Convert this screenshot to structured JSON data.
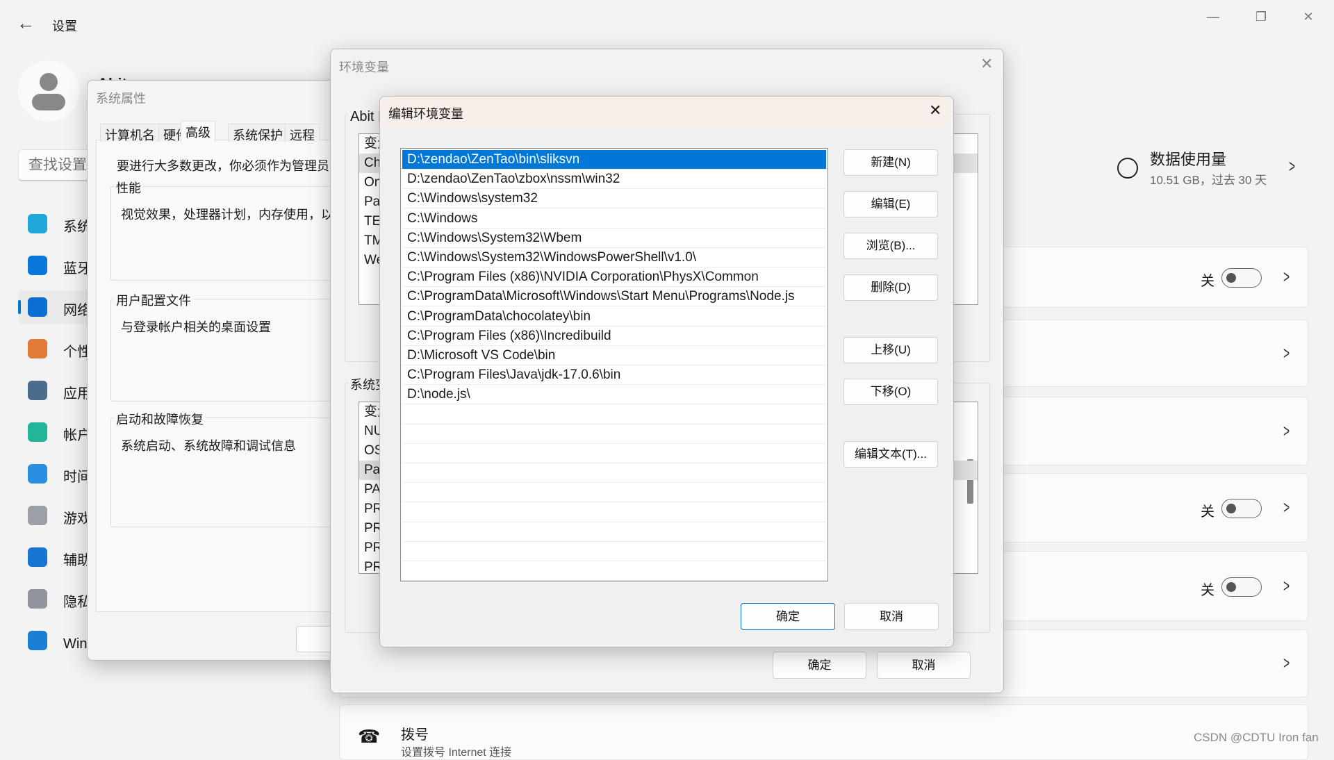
{
  "settings": {
    "title": "设置",
    "search_placeholder": "查找设置",
    "user_name": "Abit",
    "sidebar": [
      {
        "label": "系统",
        "icon": "system-icon",
        "color": "#1ea7d8"
      },
      {
        "label": "蓝牙和其他设备",
        "icon": "bluetooth-icon",
        "color": "#0a76d8"
      },
      {
        "label": "网络和 Internet",
        "icon": "wifi-icon",
        "color": "#0a6fd1",
        "active": true
      },
      {
        "label": "个性化",
        "icon": "brush-icon",
        "color": "#e07a36"
      },
      {
        "label": "应用",
        "icon": "apps-icon",
        "color": "#4a6d8c"
      },
      {
        "label": "帐户",
        "icon": "account-icon",
        "color": "#22b59a"
      },
      {
        "label": "时间和语言",
        "icon": "globe-clock-icon",
        "color": "#2a8fe0"
      },
      {
        "label": "游戏",
        "icon": "gamepad-icon",
        "color": "#9aa0a6"
      },
      {
        "label": "辅助功能",
        "icon": "accessibility-icon",
        "color": "#1675d1"
      },
      {
        "label": "隐私和安全性",
        "icon": "shield-icon",
        "color": "#8f959b"
      },
      {
        "label": "Windows 更新",
        "icon": "update-icon",
        "color": "#1a7fd4"
      }
    ],
    "data_usage": {
      "title": "数据使用量",
      "subtitle": "10.51 GB，过去 30 天"
    },
    "toggle_off_label": "关",
    "dialup": {
      "title": "拨号",
      "subtitle": "设置拨号 Internet 连接"
    },
    "accent": "#0078d4"
  },
  "sysprops": {
    "title": "系统属性",
    "tabs": [
      "计算机名",
      "硬件",
      "高级",
      "系统保护",
      "远程"
    ],
    "active_tab": "高级",
    "admin_note": "要进行大多数更改，你必须作为管理员登录。",
    "groups": [
      {
        "label": "性能",
        "desc": "视觉效果，处理器计划，内存使用，以及虚拟内存"
      },
      {
        "label": "用户配置文件",
        "desc": "与登录帐户相关的桌面设置"
      },
      {
        "label": "启动和故障恢复",
        "desc": "系统启动、系统故障和调试信息"
      }
    ]
  },
  "envvars": {
    "title": "环境变量",
    "user_group_label": "Abit 的用户变量",
    "user_rows": [
      "变量",
      "ChocolateyLastPathUpdate",
      "OneDrive",
      "Path",
      "TEMP",
      "TMP",
      "WebStorm"
    ],
    "system_group_label": "系统变量",
    "system_rows": [
      "变量",
      "NUMBER_OF_PROCESSORS",
      "OS",
      "Path",
      "PATHEXT",
      "PROCESSOR_ARCHITECTURE",
      "PROCESSOR_IDENTIFIER",
      "PROCESSOR_LEVEL",
      "PROCESSOR_REVISION"
    ],
    "ok": "确定",
    "cancel": "取消"
  },
  "editenv": {
    "title": "编辑环境变量",
    "paths": [
      "D:\\zendao\\ZenTao\\bin\\sliksvn",
      "D:\\zendao\\ZenTao\\zbox\\nssm\\win32",
      "C:\\Windows\\system32",
      "C:\\Windows",
      "C:\\Windows\\System32\\Wbem",
      "C:\\Windows\\System32\\WindowsPowerShell\\v1.0\\",
      "C:\\Program Files (x86)\\NVIDIA Corporation\\PhysX\\Common",
      "C:\\ProgramData\\Microsoft\\Windows\\Start Menu\\Programs\\Node.js",
      "C:\\ProgramData\\chocolatey\\bin",
      "C:\\Program Files (x86)\\Incredibuild",
      "D:\\Microsoft VS Code\\bin",
      "C:\\Program Files\\Java\\jdk-17.0.6\\bin",
      "D:\\node.js\\"
    ],
    "selected_index": 0,
    "buttons": {
      "new": "新建(N)",
      "edit": "编辑(E)",
      "browse": "浏览(B)...",
      "delete": "删除(D)",
      "up": "上移(U)",
      "down": "下移(O)",
      "edit_text": "编辑文本(T)..."
    },
    "ok": "确定",
    "cancel": "取消"
  },
  "watermark": "CSDN @CDTU Iron fan"
}
